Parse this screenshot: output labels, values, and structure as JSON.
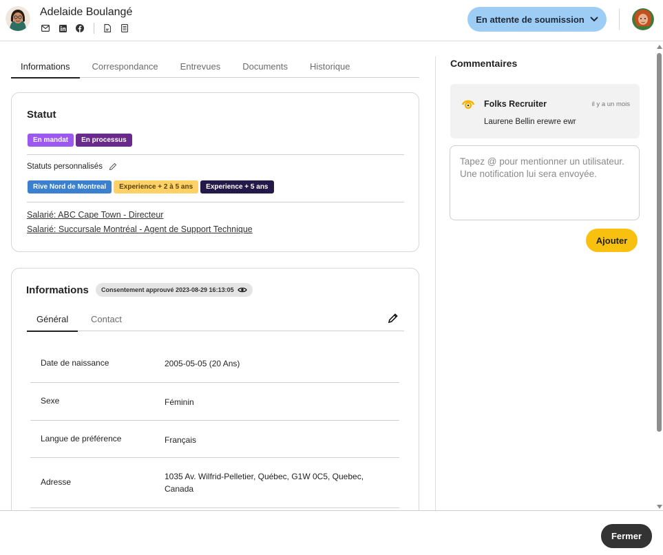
{
  "candidate": {
    "name": "Adelaide Boulangé",
    "status_button_label": "En attente de soumission"
  },
  "tabs": [
    "Informations",
    "Correspondance",
    "Entrevues",
    "Documents",
    "Historique"
  ],
  "status_card": {
    "title": "Statut",
    "chips": [
      {
        "label": "En mandat",
        "bg": "#9b59f0",
        "color": "#ffffff"
      },
      {
        "label": "En processus",
        "bg": "#6a2a8c",
        "color": "#ffffff"
      }
    ],
    "custom_label": "Statuts personnalisés",
    "custom_chips": [
      {
        "label": "Rive Nord de Montreal",
        "bg": "#3b7fcf",
        "color": "#ffffff"
      },
      {
        "label": "Experience + 2 à 5 ans",
        "bg": "#ffd166",
        "color": "#5a4200"
      },
      {
        "label": "Experience + 5 ans",
        "bg": "#241a4a",
        "color": "#ffffff"
      }
    ],
    "links": [
      "Salarié: ABC Cape Town - Directeur",
      "Salarié: Succursale Montréal - Agent de Support Technique"
    ]
  },
  "info_card": {
    "title": "Informations",
    "consent": "Consentement approuvé 2023-08-29 16:13:05",
    "subtabs": [
      "Général",
      "Contact"
    ],
    "rows": [
      {
        "label": "Date de naissance",
        "value": "2005-05-05 (20 Ans)"
      },
      {
        "label": "Sexe",
        "value": "Féminin"
      },
      {
        "label": "Langue de préférence",
        "value": "Français"
      },
      {
        "label": "Adresse",
        "value": "1035 Av. Wilfrid-Pelletier, Québec, G1W 0C5, Quebec, Canada"
      }
    ]
  },
  "comments": {
    "title": "Commentaires",
    "items": [
      {
        "author": "Folks Recruiter",
        "time": "il y a un mois",
        "text": "Laurene Bellin erewre ewr"
      }
    ],
    "placeholder": "Tapez @ pour mentionner un utilisateur. Une notification lui sera envoyée.",
    "add_label": "Ajouter"
  },
  "footer": {
    "close_label": "Fermer"
  },
  "colors": {
    "status_button": "#9dcdf5",
    "add_button": "#f9c10f",
    "close_button": "#333333"
  },
  "icons": [
    "mail-icon",
    "linkedin-icon",
    "facebook-icon",
    "pdf-icon",
    "document-icon",
    "chevron-down-icon",
    "pencil-icon",
    "eye-icon",
    "edit-icon"
  ]
}
